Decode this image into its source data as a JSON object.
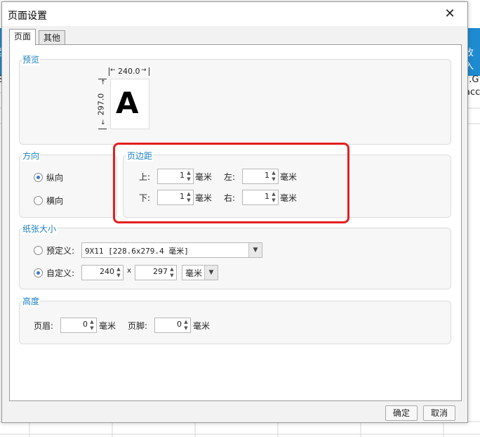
{
  "background": {
    "header_fragments": [
      "型",
      "收入"
    ],
    "cell_fragments": [
      "S(",
      "1.G",
      "acc"
    ]
  },
  "dialog": {
    "title": "页面设置",
    "close_glyph": "✕",
    "tabs": [
      {
        "label": "页面",
        "active": true
      },
      {
        "label": "其他",
        "active": false
      }
    ],
    "preview": {
      "title": "预览",
      "width_label": "240.0",
      "height_label": "297.0",
      "letter": "A"
    },
    "orientation": {
      "title": "方向",
      "options": [
        {
          "label": "纵向",
          "selected": true
        },
        {
          "label": "横向",
          "selected": false
        }
      ]
    },
    "margins": {
      "title": "页边距",
      "top_label": "上:",
      "top_value": "1",
      "left_label": "左:",
      "left_value": "1",
      "bottom_label": "下:",
      "bottom_value": "1",
      "right_label": "右:",
      "right_value": "1",
      "unit": "毫米"
    },
    "paper": {
      "title": "纸张大小",
      "preset_label": "预定义:",
      "preset_selected": false,
      "preset_value": "9X11 [228.6x279.4 毫米]",
      "custom_label": "自定义:",
      "custom_selected": true,
      "custom_width": "240",
      "custom_height": "297",
      "times": "x",
      "unit_value": "毫米"
    },
    "height": {
      "title": "高度",
      "header_label": "页眉:",
      "header_value": "0",
      "footer_label": "页脚:",
      "footer_value": "0",
      "unit": "毫米"
    },
    "ok_label": "确定",
    "cancel_label": "取消"
  },
  "colors": {
    "accent_title": "#1a7fc1",
    "highlight_box": "#e41f1f",
    "header_bar": "#1e8bd0"
  }
}
